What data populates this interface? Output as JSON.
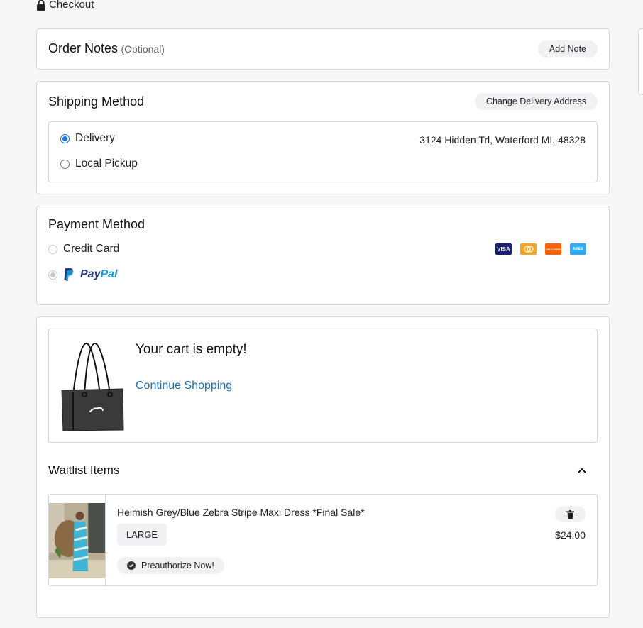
{
  "header": {
    "title": "Checkout",
    "icon": "lock-icon"
  },
  "order_notes": {
    "title": "Order Notes",
    "optional_label": "(Optional)",
    "add_note_label": "Add Note"
  },
  "shipping": {
    "title": "Shipping Method",
    "change_address_label": "Change Delivery Address",
    "options": [
      {
        "label": "Delivery",
        "selected": true
      },
      {
        "label": "Local Pickup",
        "selected": false
      }
    ],
    "address": "3124 Hidden Trl, Waterford MI, 48328"
  },
  "payment": {
    "title": "Payment Method",
    "options": [
      {
        "label": "Credit Card",
        "selected": false
      },
      {
        "label": "PayPal",
        "selected": true
      }
    ],
    "paypal_pay": "Pay",
    "paypal_pal": "Pal",
    "card_icons": [
      {
        "name": "visa-icon",
        "text": "VISA",
        "color": "#1a1f71"
      },
      {
        "name": "mastercard-icon",
        "text": "",
        "color": "#f5a623"
      },
      {
        "name": "discover-icon",
        "text": "DISCOVER",
        "color": "#ff6000"
      },
      {
        "name": "amex-icon",
        "text": "AMEX",
        "color": "#2fabf7"
      }
    ]
  },
  "cart": {
    "empty_message": "Your cart is empty!",
    "continue_label": "Continue Shopping",
    "link_color": "#1d6fb3"
  },
  "waitlist": {
    "title": "Waitlist Items",
    "items": [
      {
        "name": "Heimish Grey/Blue Zebra Stripe Maxi Dress *Final Sale*",
        "size": "LARGE",
        "preauth_label": "Preauthorize Now!",
        "price": "$24.00"
      }
    ]
  }
}
